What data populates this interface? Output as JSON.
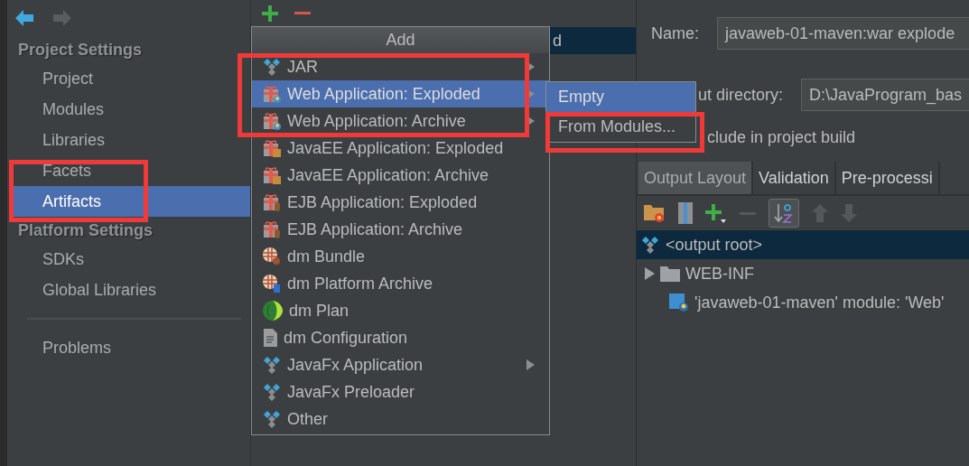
{
  "sidebar": {
    "sections": [
      {
        "title": "Project Settings",
        "items": [
          {
            "label": "Project",
            "selected": false
          },
          {
            "label": "Modules",
            "selected": false
          },
          {
            "label": "Libraries",
            "selected": false
          },
          {
            "label": "Facets",
            "selected": false
          },
          {
            "label": "Artifacts",
            "selected": true
          }
        ]
      },
      {
        "title": "Platform Settings",
        "items": [
          {
            "label": "SDKs",
            "selected": false
          },
          {
            "label": "Global Libraries",
            "selected": false
          }
        ]
      },
      {
        "items": [
          {
            "label": "Problems",
            "selected": false
          }
        ]
      }
    ]
  },
  "artifact_list": {
    "rows": [
      {
        "label": "d",
        "selected": true
      }
    ]
  },
  "add_menu": {
    "title": "Add",
    "items": [
      {
        "label": "JAR",
        "kind": "jar",
        "submenu": true,
        "selected": false
      },
      {
        "label": "Web Application: Exploded",
        "kind": "web",
        "submenu": true,
        "selected": true
      },
      {
        "label": "Web Application: Archive",
        "kind": "web",
        "submenu": true,
        "selected": false
      },
      {
        "label": "JavaEE Application: Exploded",
        "kind": "javaee",
        "submenu": false,
        "selected": false
      },
      {
        "label": "JavaEE Application: Archive",
        "kind": "javaee",
        "submenu": false,
        "selected": false
      },
      {
        "label": "EJB Application: Exploded",
        "kind": "ejb",
        "submenu": false,
        "selected": false
      },
      {
        "label": "EJB Application: Archive",
        "kind": "ejb",
        "submenu": false,
        "selected": false
      },
      {
        "label": "dm Bundle",
        "kind": "bundle",
        "submenu": false,
        "selected": false
      },
      {
        "label": "dm Platform Archive",
        "kind": "platform",
        "submenu": false,
        "selected": false
      },
      {
        "label": "dm Plan",
        "kind": "plan",
        "submenu": false,
        "selected": false
      },
      {
        "label": "dm Configuration",
        "kind": "config",
        "submenu": false,
        "selected": false
      },
      {
        "label": "JavaFx Application",
        "kind": "jar",
        "submenu": true,
        "selected": false
      },
      {
        "label": "JavaFx Preloader",
        "kind": "jar",
        "submenu": false,
        "selected": false
      },
      {
        "label": "Other",
        "kind": "jar",
        "submenu": false,
        "selected": false
      }
    ]
  },
  "submenu": {
    "items": [
      {
        "label": "Empty",
        "selected": true
      },
      {
        "label": "From Modules...",
        "selected": false
      }
    ]
  },
  "form": {
    "name_label": "Name:",
    "name_value": "javaweb-01-maven:war explode",
    "output_label": "ut directory:",
    "output_value": "D:\\JavaProgram_bas",
    "include_label": "clude in project build"
  },
  "tabs": [
    {
      "label": "Output Layout",
      "selected": true
    },
    {
      "label": "Validation",
      "selected": false
    },
    {
      "label": "Pre-processi",
      "selected": false
    }
  ],
  "tree": [
    {
      "label": "<output root>",
      "kind": "root",
      "selected": true
    },
    {
      "label": "WEB-INF",
      "kind": "folder",
      "selected": false,
      "expanded": false
    },
    {
      "label": "'javaweb-01-maven' module: 'Web'",
      "kind": "module",
      "selected": false
    }
  ]
}
